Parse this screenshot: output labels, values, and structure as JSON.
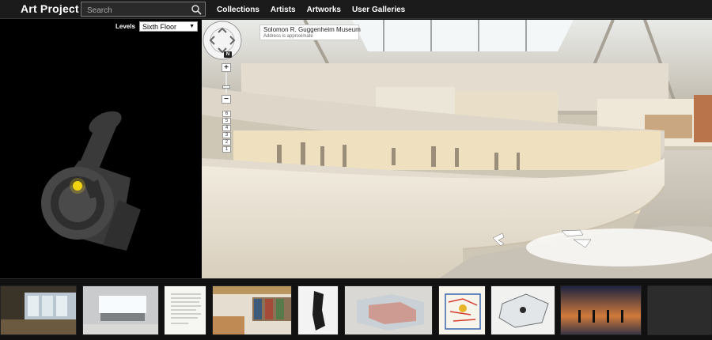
{
  "header": {
    "title": "Art Project",
    "search_placeholder": "Search",
    "nav": [
      {
        "label": "Collections"
      },
      {
        "label": "Artists"
      },
      {
        "label": "Artworks"
      },
      {
        "label": "User Galleries"
      }
    ]
  },
  "floorplan": {
    "levels_label": "Levels",
    "selected_level": "Sixth Floor"
  },
  "viewer": {
    "place_name": "Solomon R. Guggenheim Museum",
    "place_note": "Address is approximate",
    "compass": "N",
    "zoom_in": "+",
    "zoom_out": "−",
    "levels": [
      "6",
      "5",
      "4",
      "3",
      "2",
      "1"
    ]
  },
  "thumbnails": [
    {
      "name": "thumb-gallery-screens"
    },
    {
      "name": "thumb-light-sculpture"
    },
    {
      "name": "thumb-letter-document"
    },
    {
      "name": "thumb-library-interior"
    },
    {
      "name": "thumb-black-sculpture"
    },
    {
      "name": "thumb-glass-structure"
    },
    {
      "name": "thumb-map-drawing"
    },
    {
      "name": "thumb-glass-case"
    },
    {
      "name": "thumb-beach-figures"
    },
    {
      "name": "thumb-dark-panel"
    }
  ],
  "colors": {
    "topbar": "#1b1b1b",
    "accent_marker": "#f2d312",
    "plan_fill": "#3a3a3a"
  }
}
